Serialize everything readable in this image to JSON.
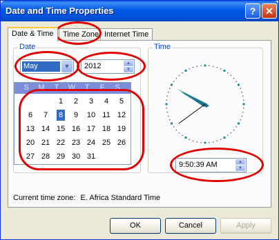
{
  "window": {
    "title": "Date and Time Properties",
    "help_glyph": "?",
    "close_glyph": "✕"
  },
  "tabs": [
    {
      "label": "Date & Time",
      "active": true
    },
    {
      "label": "Time Zone",
      "active": false
    },
    {
      "label": "Internet Time",
      "active": false
    }
  ],
  "date": {
    "group_label": "Date",
    "month": "May",
    "year": "2012",
    "weekdays": [
      "S",
      "M",
      "T",
      "W",
      "T",
      "F",
      "S"
    ],
    "days": [
      [
        "",
        "",
        "1",
        "2",
        "3",
        "4",
        "5"
      ],
      [
        "6",
        "7",
        "8",
        "9",
        "10",
        "11",
        "12"
      ],
      [
        "13",
        "14",
        "15",
        "16",
        "17",
        "18",
        "19"
      ],
      [
        "20",
        "21",
        "22",
        "23",
        "24",
        "25",
        "26"
      ],
      [
        "27",
        "28",
        "29",
        "30",
        "31",
        "",
        ""
      ]
    ],
    "selected_day": "8"
  },
  "time": {
    "group_label": "Time",
    "value": "9:50:39 AM"
  },
  "timezone": {
    "label": "Current time zone:",
    "value": "E. Africa Standard Time"
  },
  "buttons": {
    "ok": "OK",
    "cancel": "Cancel",
    "apply": "Apply"
  },
  "colors": {
    "title_blue": "#0058e6",
    "selection": "#316ac5",
    "annotation": "#e00000"
  },
  "icons": {
    "dropdown": "chevron-down-icon",
    "spin": "spin-arrows-icon"
  }
}
